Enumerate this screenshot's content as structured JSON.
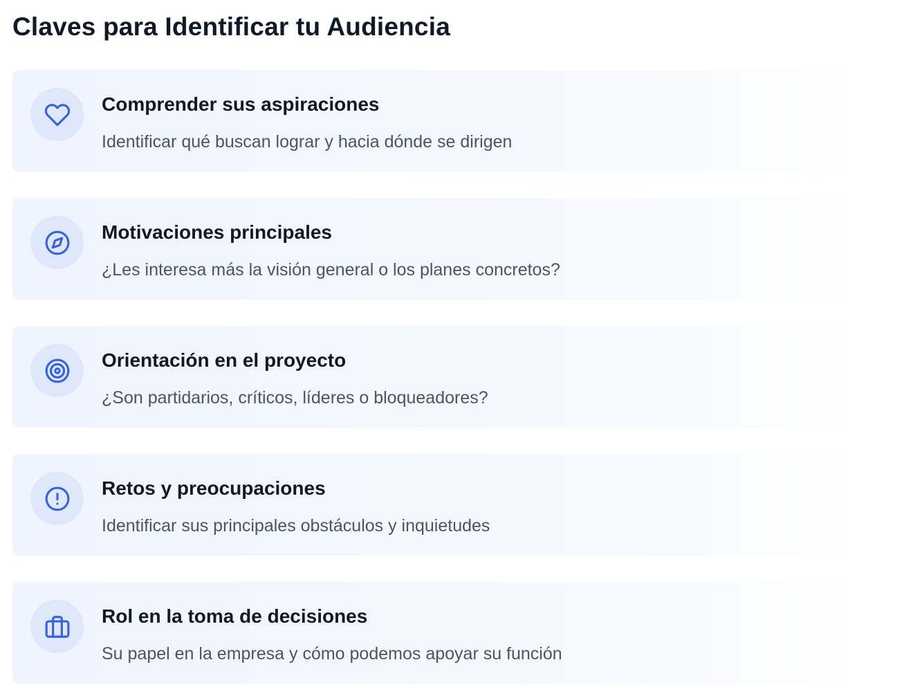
{
  "page": {
    "title": "Claves para Identificar tu Audiencia"
  },
  "accent_color": "#3b63d9",
  "icon_background": "#dfe8fa",
  "cards": [
    {
      "icon": "heart-icon",
      "title": "Comprender sus aspiraciones",
      "description": "Identificar qué buscan lograr y hacia dónde se dirigen"
    },
    {
      "icon": "compass-icon",
      "title": "Motivaciones principales",
      "description": "¿Les interesa más la visión general o los planes concretos?"
    },
    {
      "icon": "target-icon",
      "title": "Orientación en el proyecto",
      "description": "¿Son partidarios, críticos, líderes o bloqueadores?"
    },
    {
      "icon": "alert-circle-icon",
      "title": "Retos y preocupaciones",
      "description": "Identificar sus principales obstáculos y inquietudes"
    },
    {
      "icon": "briefcase-icon",
      "title": "Rol en la toma de decisiones",
      "description": "Su papel en la empresa y cómo podemos apoyar su función"
    }
  ]
}
